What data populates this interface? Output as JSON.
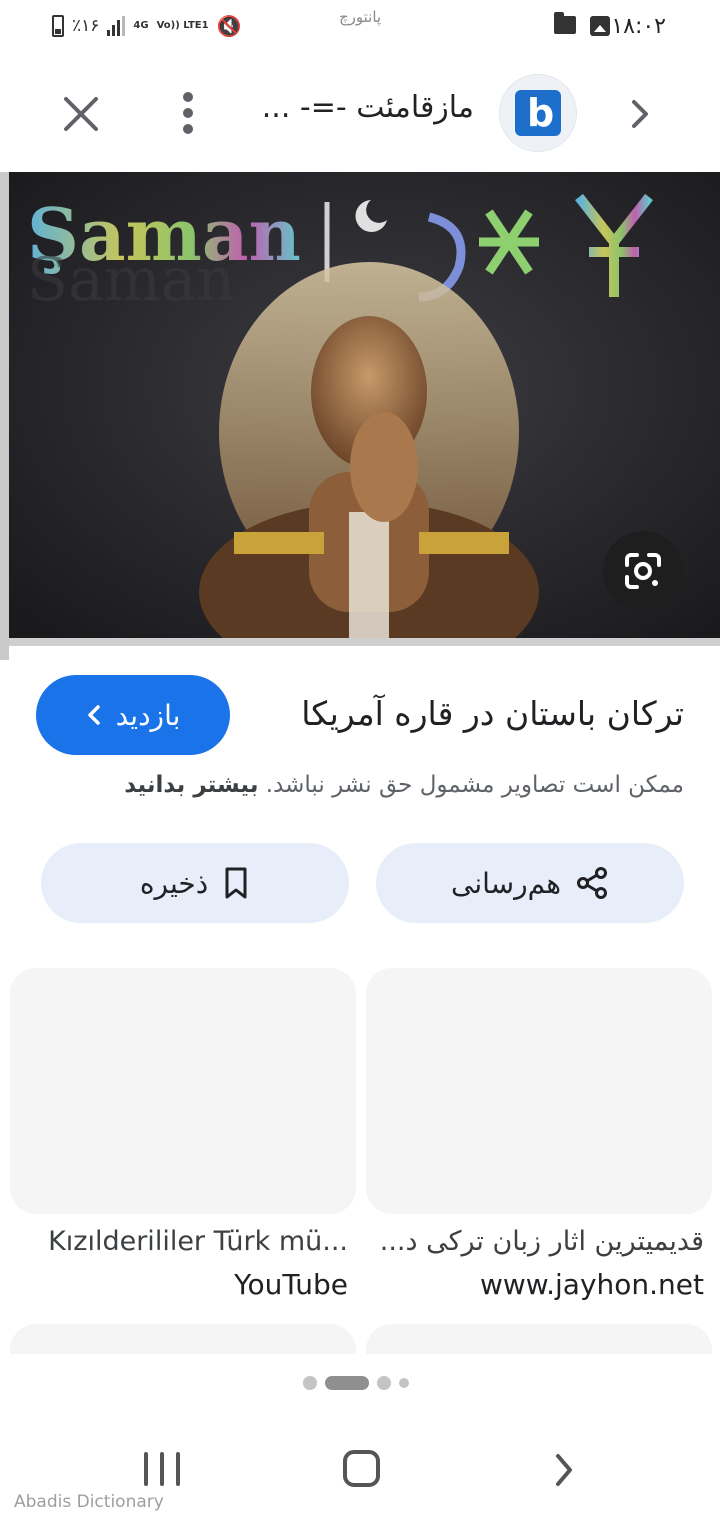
{
  "status_bar": {
    "time": "۱۸:۰۲",
    "center_label": "پانتورچ",
    "battery": "٪۱۶",
    "network": "4G",
    "volte": "Vo)) LTE1"
  },
  "header": {
    "title": "مازقامئت -=- ...",
    "close_icon": "close-icon",
    "more_icon": "more-vert-icon",
    "back_icon": "chevron-right-icon"
  },
  "hero": {
    "overlay_text": "Şaman"
  },
  "result": {
    "title": "ترکان باستان در قاره آمریکا",
    "visit_label": "بازدید",
    "copyright_text": "ممکن است تصاویر مشمول حق نشر نباشد.",
    "learn_more": "بیشتر بدانید",
    "share_label": "هم‌رسانی",
    "save_label": "ذخیره"
  },
  "related": [
    {
      "title": "قدیمیترین اثار زبان ترکی د...",
      "source": "www.jayhon.net"
    },
    {
      "title": "Kızılderililer Türk mü...",
      "source": "YouTube"
    }
  ],
  "footer": {
    "watermark": "Abadis Dictionary"
  },
  "colors": {
    "accent": "#1a73e8",
    "pill_bg": "#e8eef9",
    "thumb_bg": "#f5f5f5"
  }
}
